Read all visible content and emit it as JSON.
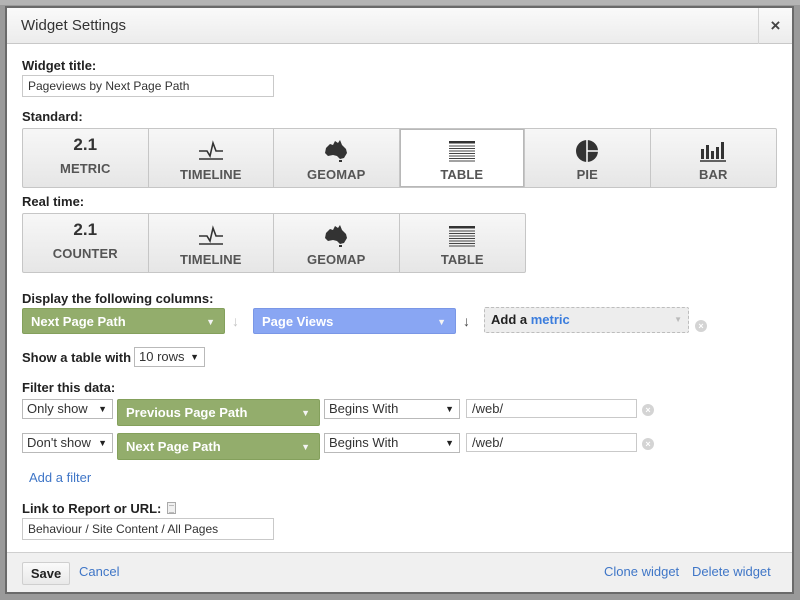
{
  "dialog": {
    "title": "Widget Settings",
    "close_icon": "×"
  },
  "widget_title": {
    "label": "Widget title:",
    "value": "Pageviews by Next Page Path"
  },
  "standard": {
    "label": "Standard:",
    "types": [
      {
        "label": "METRIC",
        "icon": "2.1",
        "icon_name": "metric-icon"
      },
      {
        "label": "TIMELINE",
        "icon_name": "timeline-icon"
      },
      {
        "label": "GEOMAP",
        "icon_name": "australia-map-icon"
      },
      {
        "label": "TABLE",
        "icon_name": "table-icon",
        "selected": true
      },
      {
        "label": "PIE",
        "icon_name": "pie-chart-icon"
      },
      {
        "label": "BAR",
        "icon_name": "bar-chart-icon"
      }
    ]
  },
  "realtime": {
    "label": "Real time:",
    "types": [
      {
        "label": "COUNTER",
        "icon": "2.1",
        "icon_name": "counter-icon"
      },
      {
        "label": "TIMELINE",
        "icon_name": "timeline-icon"
      },
      {
        "label": "GEOMAP",
        "icon_name": "australia-map-icon"
      },
      {
        "label": "TABLE",
        "icon_name": "table-icon"
      }
    ]
  },
  "columns": {
    "label": "Display the following columns:",
    "dimension": "Next Page Path",
    "metric": "Page Views",
    "add_metric_prefix": "Add a",
    "add_metric_link": "metric",
    "sort_arrow": "↓",
    "caret": "▼",
    "remove": "×"
  },
  "rows": {
    "label": "Show a table with",
    "value": "10 rows"
  },
  "filters": {
    "label": "Filter this data:",
    "items": [
      {
        "mode": "Only show",
        "dimension": "Previous Page Path",
        "condition": "Begins With",
        "value": "/web/"
      },
      {
        "mode": "Don't show",
        "dimension": "Next Page Path",
        "condition": "Begins With",
        "value": "/web/"
      }
    ],
    "add_filter": "Add a filter"
  },
  "link": {
    "label": "Link to Report or URL:",
    "value": "Behaviour / Site Content / All Pages"
  },
  "footer": {
    "save": "Save",
    "cancel": "Cancel",
    "clone": "Clone widget",
    "delete": "Delete widget"
  },
  "colors": {
    "dimension_green": "#93ad6c",
    "metric_blue": "#89a6f3",
    "link_blue": "#3f76c7"
  }
}
